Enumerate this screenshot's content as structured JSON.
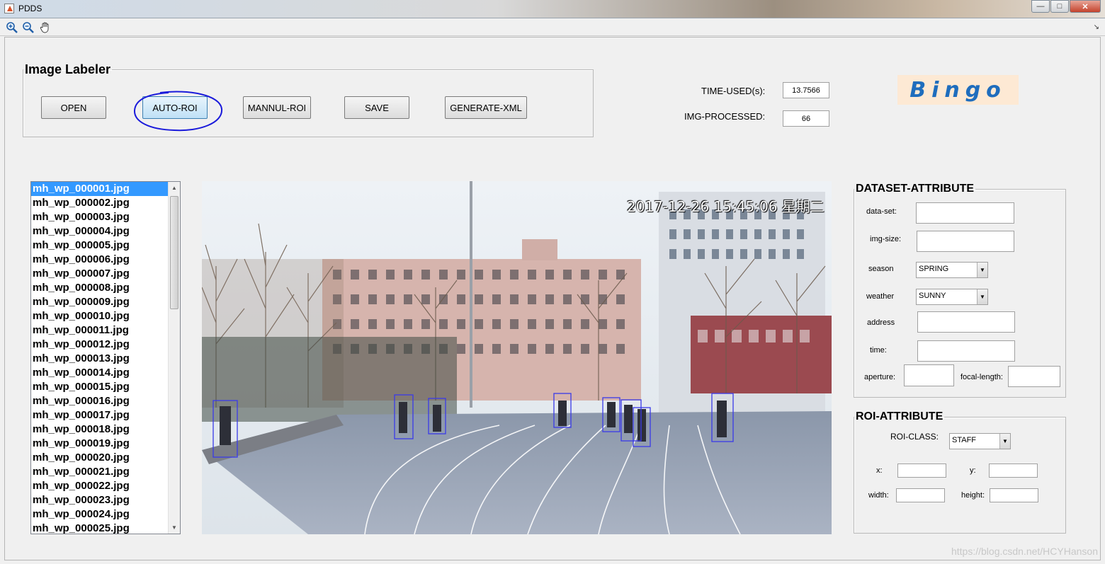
{
  "window": {
    "title": "PDDS"
  },
  "toolbar": {
    "tools": [
      "zoom-in-icon",
      "zoom-out-icon",
      "pan-hand-icon"
    ]
  },
  "image_labeler": {
    "title": "Image Labeler",
    "buttons": {
      "open": "OPEN",
      "auto_roi": "AUTO-ROI",
      "mannul_roi": "MANNUL-ROI",
      "save": "SAVE",
      "generate_xml": "GENERATE-XML"
    }
  },
  "stats": {
    "time_used_label": "TIME-USED(s):",
    "time_used_value": "13.7566",
    "img_processed_label": "IMG-PROCESSED:",
    "img_processed_value": "66"
  },
  "badge": "Bingo",
  "file_list": {
    "selected_index": 0,
    "items": [
      "mh_wp_000001.jpg",
      "mh_wp_000002.jpg",
      "mh_wp_000003.jpg",
      "mh_wp_000004.jpg",
      "mh_wp_000005.jpg",
      "mh_wp_000006.jpg",
      "mh_wp_000007.jpg",
      "mh_wp_000008.jpg",
      "mh_wp_000009.jpg",
      "mh_wp_000010.jpg",
      "mh_wp_000011.jpg",
      "mh_wp_000012.jpg",
      "mh_wp_000013.jpg",
      "mh_wp_000014.jpg",
      "mh_wp_000015.jpg",
      "mh_wp_000016.jpg",
      "mh_wp_000017.jpg",
      "mh_wp_000018.jpg",
      "mh_wp_000019.jpg",
      "mh_wp_000020.jpg",
      "mh_wp_000021.jpg",
      "mh_wp_000022.jpg",
      "mh_wp_000023.jpg",
      "mh_wp_000024.jpg",
      "mh_wp_000025.jpg"
    ]
  },
  "preview": {
    "timestamp": "2017-12-26 15:45:06 星期二"
  },
  "dataset_attribute": {
    "title": "DATASET-ATTRIBUTE",
    "data_set_label": "data-set:",
    "data_set_value": "",
    "img_size_label": "img-size:",
    "img_size_value": "",
    "season_label": "season",
    "season_value": "SPRING",
    "weather_label": "weather",
    "weather_value": "SUNNY",
    "address_label": "address",
    "address_value": "",
    "time_label": "time:",
    "time_value": "",
    "aperture_label": "aperture:",
    "aperture_value": "",
    "focal_length_label": "focal-length:",
    "focal_length_value": ""
  },
  "roi_attribute": {
    "title": "ROI-ATTRIBUTE",
    "roi_class_label": "ROI-CLASS:",
    "roi_class_value": "STAFF",
    "x_label": "x:",
    "x_value": "",
    "y_label": "y:",
    "y_value": "",
    "width_label": "width:",
    "width_value": "",
    "height_label": "height:",
    "height_value": ""
  },
  "watermark": "https://blog.csdn.net/HCYHanson"
}
